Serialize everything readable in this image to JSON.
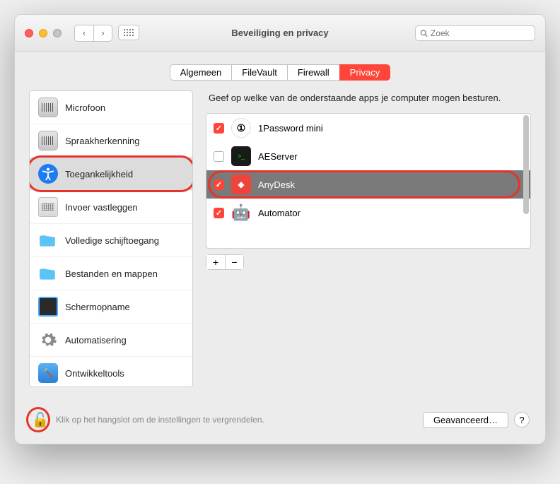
{
  "window": {
    "title": "Beveiliging en privacy"
  },
  "search": {
    "placeholder": "Zoek"
  },
  "tabs": [
    {
      "label": "Algemeen",
      "active": false
    },
    {
      "label": "FileVault",
      "active": false
    },
    {
      "label": "Firewall",
      "active": false
    },
    {
      "label": "Privacy",
      "active": true
    }
  ],
  "sidebar": {
    "items": [
      {
        "label": "Microfoon",
        "icon": "mic"
      },
      {
        "label": "Spraakherkenning",
        "icon": "speech"
      },
      {
        "label": "Toegankelijkheid",
        "icon": "access",
        "selected": true,
        "highlighted": true
      },
      {
        "label": "Invoer vastleggen",
        "icon": "keyboard"
      },
      {
        "label": "Volledige schijftoegang",
        "icon": "folder"
      },
      {
        "label": "Bestanden en mappen",
        "icon": "folder"
      },
      {
        "label": "Schermopname",
        "icon": "screen"
      },
      {
        "label": "Automatisering",
        "icon": "gear"
      },
      {
        "label": "Ontwikkeltools",
        "icon": "dev"
      }
    ]
  },
  "panel": {
    "description": "Geef op welke van de onderstaande apps je computer mogen besturen.",
    "apps": [
      {
        "name": "1Password mini",
        "checked": true,
        "icon": "1p"
      },
      {
        "name": "AEServer",
        "checked": false,
        "icon": "ae"
      },
      {
        "name": "AnyDesk",
        "checked": true,
        "icon": "any",
        "selected": true,
        "highlighted": true
      },
      {
        "name": "Automator",
        "checked": true,
        "icon": "auto"
      }
    ]
  },
  "footer": {
    "lock_text": "Klik op het hangslot om de instellingen te vergrendelen.",
    "advanced": "Geavanceerd…",
    "lock_highlighted": true
  }
}
